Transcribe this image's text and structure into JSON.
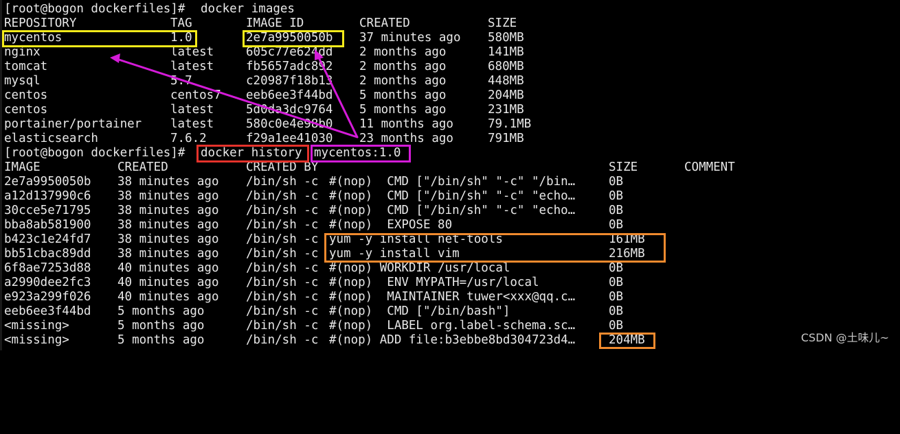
{
  "terminal": {
    "images_command": {
      "prompt": "[root@bogon dockerfiles]#",
      "command": "docker images"
    },
    "images_headers": {
      "repository": "REPOSITORY",
      "tag": "TAG",
      "image_id": "IMAGE ID",
      "created": "CREATED",
      "size": "SIZE"
    },
    "images_rows": [
      {
        "repository": "mycentos",
        "tag": "1.0",
        "image_id": "2e7a9950050b",
        "created": "37 minutes ago",
        "size": "580MB"
      },
      {
        "repository": "nginx",
        "tag": "latest",
        "image_id": "605c77e624dd",
        "created": "2 months ago",
        "size": "141MB"
      },
      {
        "repository": "tomcat",
        "tag": "latest",
        "image_id": "fb5657adc892",
        "created": "2 months ago",
        "size": "680MB"
      },
      {
        "repository": "mysql",
        "tag": "5.7",
        "image_id": "c20987f18b13",
        "created": "2 months ago",
        "size": "448MB"
      },
      {
        "repository": "centos",
        "tag": "centos7",
        "image_id": "eeb6ee3f44bd",
        "created": "5 months ago",
        "size": "204MB"
      },
      {
        "repository": "centos",
        "tag": "latest",
        "image_id": "5d0da3dc9764",
        "created": "5 months ago",
        "size": "231MB"
      },
      {
        "repository": "portainer/portainer",
        "tag": "latest",
        "image_id": "580c0e4e98b0",
        "created": "11 months ago",
        "size": "79.1MB"
      },
      {
        "repository": "elasticsearch",
        "tag": "7.6.2",
        "image_id": "f29a1ee41030",
        "created": "23 months ago",
        "size": "791MB"
      }
    ],
    "history_command": {
      "prompt": "[root@bogon dockerfiles]#",
      "command": "docker history",
      "argument": "mycentos:1.0"
    },
    "history_headers": {
      "image": "IMAGE",
      "created": "CREATED",
      "created_by": "CREATED BY",
      "size": "SIZE",
      "comment": "COMMENT"
    },
    "history_rows": [
      {
        "image": "2e7a9950050b",
        "created": "38 minutes ago",
        "shell": "/bin/sh -c ",
        "instruction": "#(nop)  CMD [\"/bin/sh\" \"-c\" \"/bin…",
        "size": "0B"
      },
      {
        "image": "a12d137990c6",
        "created": "38 minutes ago",
        "shell": "/bin/sh -c ",
        "instruction": "#(nop)  CMD [\"/bin/sh\" \"-c\" \"echo…",
        "size": "0B"
      },
      {
        "image": "30cce5e71795",
        "created": "38 minutes ago",
        "shell": "/bin/sh -c ",
        "instruction": "#(nop)  CMD [\"/bin/sh\" \"-c\" \"echo…",
        "size": "0B"
      },
      {
        "image": "bba8ab581900",
        "created": "38 minutes ago",
        "shell": "/bin/sh -c ",
        "instruction": "#(nop)  EXPOSE 80",
        "size": "0B"
      },
      {
        "image": "b423c1e24fd7",
        "created": "38 minutes ago",
        "shell": "/bin/sh -c ",
        "instruction": "yum -y install net-tools",
        "size": "161MB"
      },
      {
        "image": "bb51cbac89dd",
        "created": "38 minutes ago",
        "shell": "/bin/sh -c ",
        "instruction": "yum -y install vim",
        "size": "216MB"
      },
      {
        "image": "6f8ae7253d88",
        "created": "40 minutes ago",
        "shell": "/bin/sh -c ",
        "instruction": "#(nop) WORKDIR /usr/local",
        "size": "0B"
      },
      {
        "image": "a2990dee2fc3",
        "created": "40 minutes ago",
        "shell": "/bin/sh -c ",
        "instruction": "#(nop)  ENV MYPATH=/usr/local",
        "size": "0B"
      },
      {
        "image": "e923a299f026",
        "created": "40 minutes ago",
        "shell": "/bin/sh -c ",
        "instruction": "#(nop)  MAINTAINER tuwer<xxx@qq.c…",
        "size": "0B"
      },
      {
        "image": "eeb6ee3f44bd",
        "created": "5 months ago",
        "shell": "/bin/sh -c ",
        "instruction": "#(nop)  CMD [\"/bin/bash\"]",
        "size": "0B"
      },
      {
        "image": "<missing>",
        "created": "5 months ago",
        "shell": "/bin/sh -c ",
        "instruction": "#(nop)  LABEL org.label-schema.sc…",
        "size": "0B"
      },
      {
        "image": "<missing>",
        "created": "5 months ago",
        "shell": "/bin/sh -c ",
        "instruction": "#(nop) ADD file:b3ebbe8bd304723d4…",
        "size": "204MB"
      }
    ]
  },
  "watermark": "CSDN @土味儿~",
  "colors": {
    "background": "#000000",
    "text": "#e8e8e8",
    "highlight_yellow": "#f4ea1a",
    "highlight_red": "#e5322b",
    "highlight_magenta": "#d41bd8",
    "highlight_orange": "#ef8a2e"
  }
}
